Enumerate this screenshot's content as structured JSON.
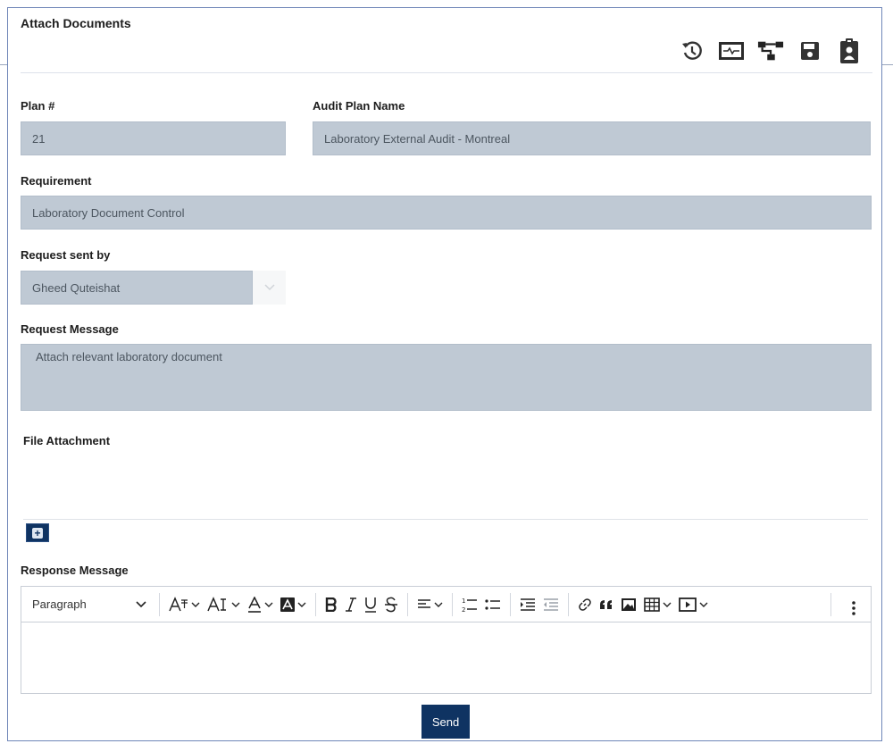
{
  "header": {
    "title": "Attach Documents",
    "icons": [
      "history-icon",
      "activity-monitor-icon",
      "workflow-icon",
      "save-icon",
      "clipboard-user-icon"
    ]
  },
  "form": {
    "plan_label": "Plan #",
    "plan_value": "21",
    "audit_plan_name_label": "Audit Plan Name",
    "audit_plan_name_value": "Laboratory External Audit - Montreal",
    "requirement_label": "Requirement",
    "requirement_value": "Laboratory Document Control",
    "request_sent_by_label": "Request sent by",
    "request_sent_by_value": "Gheed Quteishat",
    "request_message_label": "Request Message",
    "request_message_value": "Attach relevant laboratory document",
    "file_attachment_label": "File Attachment",
    "response_message_label": "Response Message"
  },
  "editor": {
    "paragraph_style": "Paragraph"
  },
  "actions": {
    "send_label": "Send",
    "add_icon": "+"
  },
  "colors": {
    "primary": "#0f3362",
    "field_bg": "#bfc9d4",
    "frame_border": "#6f86b8"
  }
}
